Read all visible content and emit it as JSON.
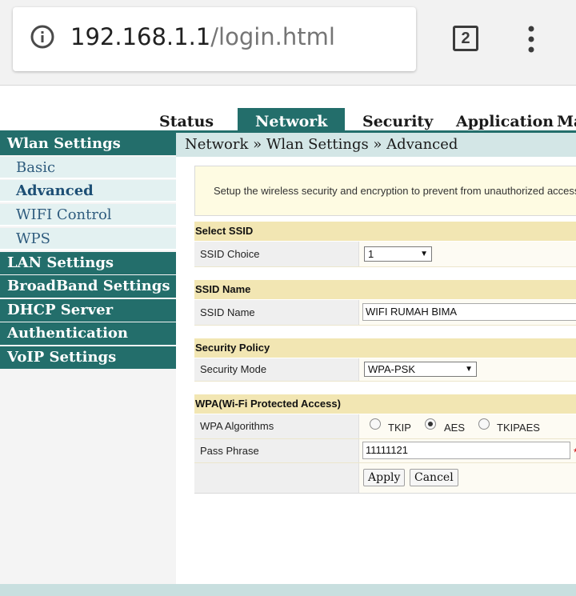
{
  "browser": {
    "url_host": "192.168.1.1",
    "url_path": "/login.html",
    "tab_count": "2",
    "icons": [
      "info-icon",
      "kebab-menu-icon"
    ]
  },
  "topnav": {
    "tabs": [
      {
        "label": "Status",
        "active": false
      },
      {
        "label": "Network",
        "active": true
      },
      {
        "label": "Security",
        "active": false
      },
      {
        "label": "Application",
        "active": false
      },
      {
        "label": "Ma",
        "active": false
      }
    ]
  },
  "sidebar": {
    "wlan": "Wlan Settings",
    "wlan_items": [
      "Basic",
      "Advanced",
      "WIFI Control",
      "WPS"
    ],
    "active_item": "Advanced",
    "groups": [
      "LAN Settings",
      "BroadBand Settings",
      "DHCP Server",
      "Authentication",
      "VoIP Settings"
    ]
  },
  "breadcrumb": "Network » Wlan Settings » Advanced",
  "notice": "Setup the wireless security and encryption to prevent from unauthorized access",
  "form": {
    "select_ssid": {
      "title": "Select SSID",
      "label": "SSID Choice",
      "value": "1"
    },
    "ssid_name": {
      "title": "SSID Name",
      "label": "SSID Name",
      "value": "WIFI RUMAH BIMA"
    },
    "security_policy": {
      "title": "Security Policy",
      "label": "Security Mode",
      "value": "WPA-PSK"
    },
    "wpa": {
      "title": "WPA(Wi-Fi Protected Access)",
      "algo_label": "WPA Algorithms",
      "algorithms": [
        "TKIP",
        "AES",
        "TKIPAES"
      ],
      "selected": "AES",
      "pass_label": "Pass Phrase",
      "pass_value": "11111121",
      "required_mark": "*"
    },
    "apply": "Apply",
    "cancel": "Cancel"
  },
  "colors": {
    "accent": "#236e6b",
    "section_header": "#f2e6b3",
    "breadcrumb_bg": "#d3e6e6"
  }
}
